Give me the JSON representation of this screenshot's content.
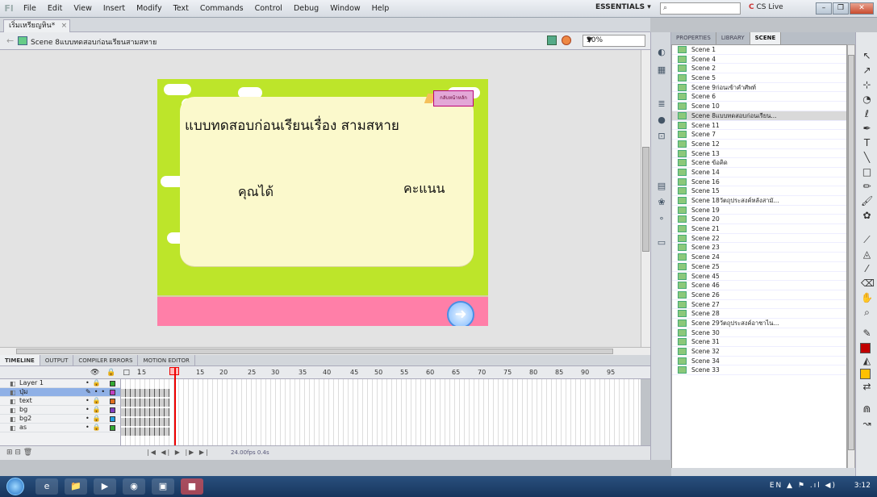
{
  "app": {
    "logo": "Fl",
    "menu": [
      "File",
      "Edit",
      "View",
      "Insert",
      "Modify",
      "Text",
      "Commands",
      "Control",
      "Debug",
      "Window",
      "Help"
    ],
    "workspace": "ESSENTIALS ▾",
    "search_placeholder": "",
    "cs_live": "CS Live",
    "window_buttons": [
      "–",
      "❐",
      "✕"
    ]
  },
  "document": {
    "tab_title": "เริ่มเหรียญหิน*",
    "tab_close": "×",
    "scene_name": "Scene 8แบบทดสอบก่อนเรียนสามสหาย",
    "zoom": "50%"
  },
  "stage": {
    "title": "แบบทดสอบก่อนเรียนเรื่อง  สามสหาย",
    "label_you_got": "คุณได้",
    "label_score": "คะแนน",
    "home_button": "กลับหน้าหลัก",
    "next_button": "➜",
    "colors": {
      "background": "#bde52a",
      "board": "#fbf9cc",
      "band": "#ff7fa8"
    }
  },
  "timeline": {
    "tabs": [
      "TIMELINE",
      "OUTPUT",
      "COMPILER ERRORS",
      "MOTION EDITOR"
    ],
    "frame_numbers": [
      "5",
      "10",
      "15",
      "20",
      "25",
      "30",
      "35",
      "40",
      "45",
      "50",
      "55",
      "60",
      "65",
      "70",
      "75",
      "80",
      "85",
      "90",
      "95"
    ],
    "header_icons": "👁 🔒 □ 1",
    "layers": [
      {
        "name": "Layer 1",
        "color": "#33aa33"
      },
      {
        "name": "ปุ่ม",
        "color": "#c040c0",
        "selected": true
      },
      {
        "name": "text",
        "color": "#e07020"
      },
      {
        "name": "bg",
        "color": "#8040c0"
      },
      {
        "name": "bg2",
        "color": "#20a0e0"
      },
      {
        "name": "as",
        "color": "#33aa33"
      }
    ],
    "footer_icons": "⊞ ⊟ 🗑",
    "controls": "|◀ ◀| ▶ |▶ ▶|",
    "fps": "24.00fps",
    "time": "0.4s"
  },
  "panel": {
    "tabs": [
      "PROPERTIES",
      "LIBRARY",
      "SCENE"
    ],
    "active_tab": "SCENE",
    "scenes": [
      "Scene 1",
      "Scene 4",
      "Scene 2",
      "Scene 5",
      "Scene 9ก่อนเข้าคำศัพท์",
      "Scene 6",
      "Scene 10",
      "Scene 8แบบทดสอบก่อนเรียน...",
      "Scene 11",
      "Scene 7",
      "Scene 12",
      "Scene 13",
      "Scene ข้อคิด",
      "Scene 14",
      "Scene 16",
      "Scene 15",
      "Scene 18วัตถุประสงค์หลังสามั...",
      "Scene 19",
      "Scene 20",
      "Scene 21",
      "Scene 22",
      "Scene 23",
      "Scene 24",
      "Scene 25",
      "Scene 45",
      "Scene 46",
      "Scene 26",
      "Scene 27",
      "Scene 28",
      "Scene 29วัตถุประสงค์อาชาไน...",
      "Scene 30",
      "Scene 31",
      "Scene 32",
      "Scene 34",
      "Scene 33"
    ],
    "selected_index": 7
  },
  "taskbar": {
    "apps": [
      "e",
      "📁",
      "▶",
      "◉",
      "▣",
      "■"
    ],
    "tray": "EN ▲ ⚑ .ıl ◀)",
    "clock": "3:12"
  }
}
